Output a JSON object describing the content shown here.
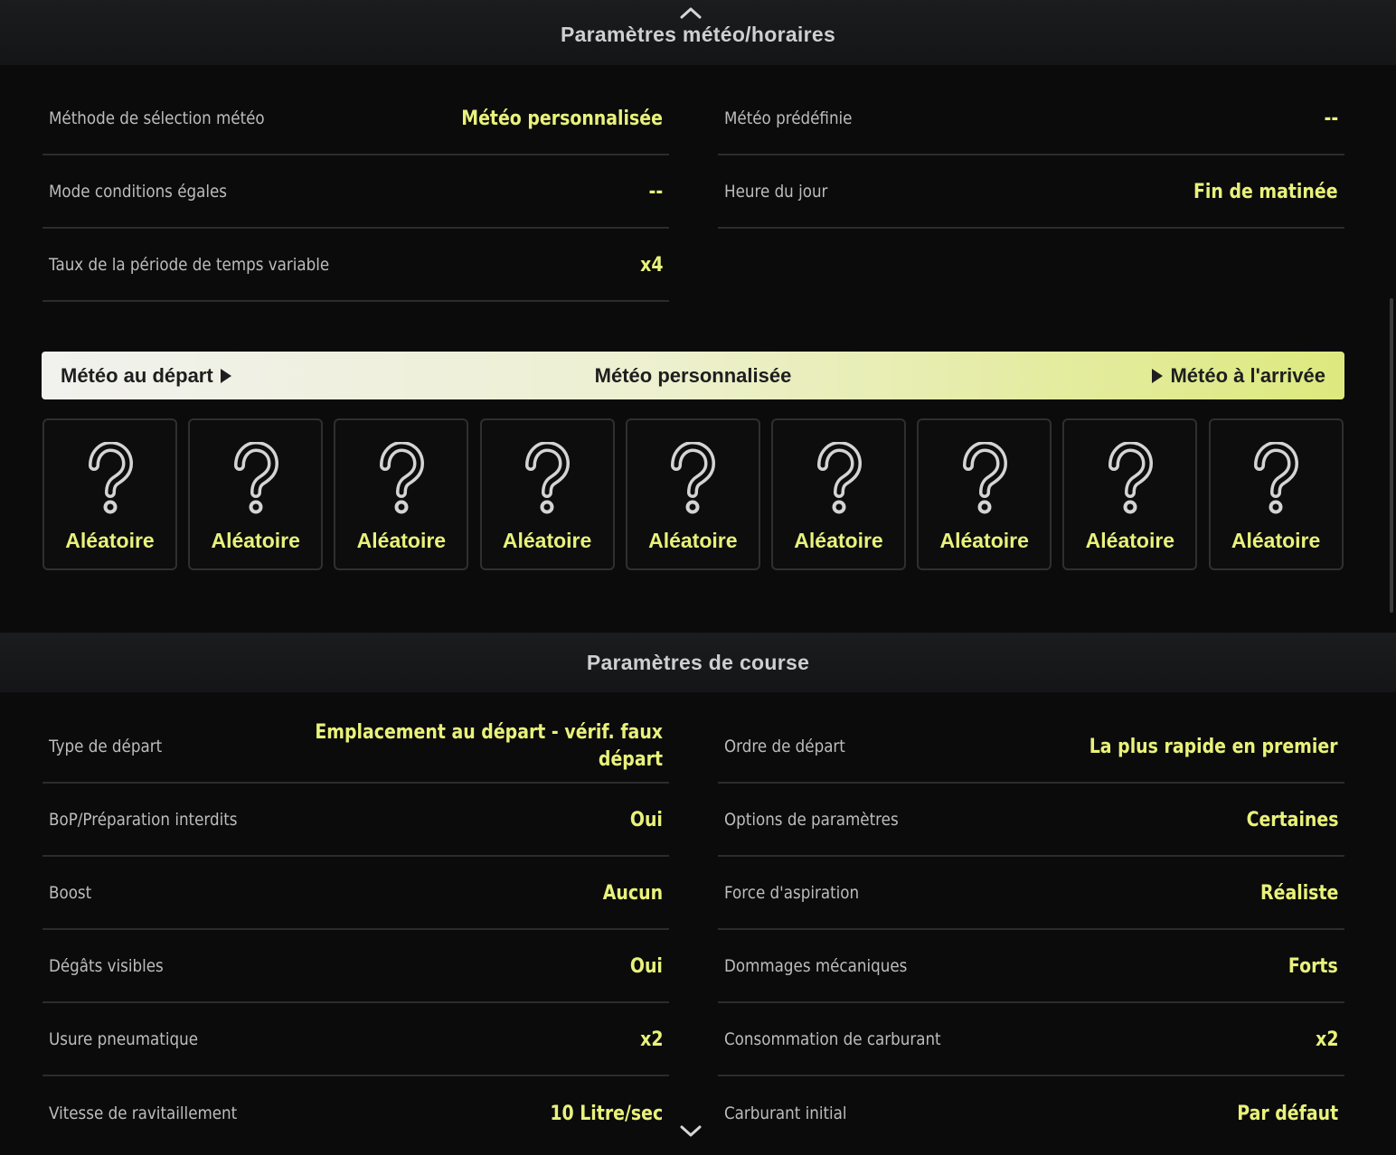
{
  "weather_section": {
    "title": "Paramètres météo/horaires",
    "rows_left": [
      {
        "label": "Méthode de sélection météo",
        "value": "Météo personnalisée"
      },
      {
        "label": "Mode conditions égales",
        "value": "--"
      },
      {
        "label": "Taux de la période de temps variable",
        "value": "x4"
      }
    ],
    "rows_right": [
      {
        "label": "Météo prédéfinie",
        "value": "--"
      },
      {
        "label": "Heure du jour",
        "value": "Fin de matinée"
      }
    ],
    "weather_bar": {
      "start_label": "Météo au départ",
      "center_label": "Météo personnalisée",
      "end_label": "Météo à l'arrivée"
    },
    "slots": [
      {
        "label": "Aléatoire"
      },
      {
        "label": "Aléatoire"
      },
      {
        "label": "Aléatoire"
      },
      {
        "label": "Aléatoire"
      },
      {
        "label": "Aléatoire"
      },
      {
        "label": "Aléatoire"
      },
      {
        "label": "Aléatoire"
      },
      {
        "label": "Aléatoire"
      },
      {
        "label": "Aléatoire"
      }
    ]
  },
  "race_section": {
    "title": "Paramètres de course",
    "rows_left": [
      {
        "label": "Type de départ",
        "value": "Emplacement au départ - vérif. faux départ"
      },
      {
        "label": "BoP/Préparation interdits",
        "value": "Oui"
      },
      {
        "label": "Boost",
        "value": "Aucun"
      },
      {
        "label": "Dégâts visibles",
        "value": "Oui"
      },
      {
        "label": "Usure pneumatique",
        "value": "x2"
      },
      {
        "label": "Vitesse de ravitaillement",
        "value": "10 Litre/sec"
      }
    ],
    "rows_right": [
      {
        "label": "Ordre de départ",
        "value": "La plus rapide en premier"
      },
      {
        "label": "Options de paramètres",
        "value": "Certaines"
      },
      {
        "label": "Force d'aspiration",
        "value": "Réaliste"
      },
      {
        "label": "Dommages mécaniques",
        "value": "Forts"
      },
      {
        "label": "Consommation de carburant",
        "value": "x2"
      },
      {
        "label": "Carburant initial",
        "value": "Par défaut"
      }
    ]
  },
  "icons": {
    "scroll_up": "chevron-up-icon",
    "scroll_down": "chevron-down-icon",
    "slot": "question-mark-icon",
    "bar_arrow": "play-triangle-icon"
  },
  "colors": {
    "accent": "#e9f27a",
    "background": "#0b0b0c",
    "divider": "#2b2c2e"
  }
}
